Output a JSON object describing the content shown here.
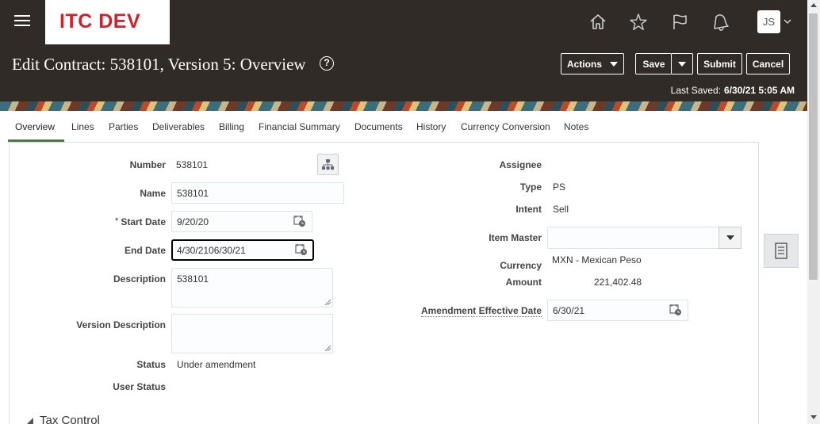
{
  "header": {
    "logo_text": "ITC DEV",
    "user_initials": "JS",
    "icons": [
      "hamburger-icon",
      "home-icon",
      "star-icon",
      "flag-icon",
      "bell-icon",
      "chevron-down-icon"
    ]
  },
  "page": {
    "title": "Edit Contract: 538101, Version 5: Overview",
    "actions_label": "Actions",
    "save_label": "Save",
    "submit_label": "Submit",
    "cancel_label": "Cancel",
    "last_saved_label": "Last Saved:",
    "last_saved_value": "6/30/21 5:05 AM"
  },
  "tabs": [
    "Overview",
    "Lines",
    "Parties",
    "Deliverables",
    "Billing",
    "Financial Summary",
    "Documents",
    "History",
    "Currency Conversion",
    "Notes"
  ],
  "left": {
    "number_label": "Number",
    "number_value": "538101",
    "name_label": "Name",
    "name_value": "538101",
    "start_date_required": "*",
    "start_date_label": "Start Date",
    "start_date_value": "9/20/20",
    "end_date_label": "End Date",
    "end_date_value": "4/30/2106/30/21",
    "description_label": "Description",
    "description_value": "538101",
    "version_description_label": "Version Description",
    "version_description_value": "",
    "status_label": "Status",
    "status_value": "Under amendment",
    "user_status_label": "User Status",
    "user_status_value": ""
  },
  "right": {
    "assignee_label": "Assignee",
    "assignee_value": "",
    "type_label": "Type",
    "type_value": "PS",
    "intent_label": "Intent",
    "intent_value": "Sell",
    "item_master_label": "Item Master",
    "item_master_value": "",
    "currency_label": "Currency",
    "currency_value": "MXN - Mexican Peso",
    "amount_label": "Amount",
    "amount_value": "221,402.48",
    "amendment_date_label": "Amendment Effective Date",
    "amendment_date_value": "6/30/21"
  },
  "sections": {
    "tax_control": "Tax Control"
  },
  "colors": {
    "header_bg": "#302b27",
    "logo_red": "#d21f2a",
    "tab_active_underline": "#4f7a3f"
  }
}
